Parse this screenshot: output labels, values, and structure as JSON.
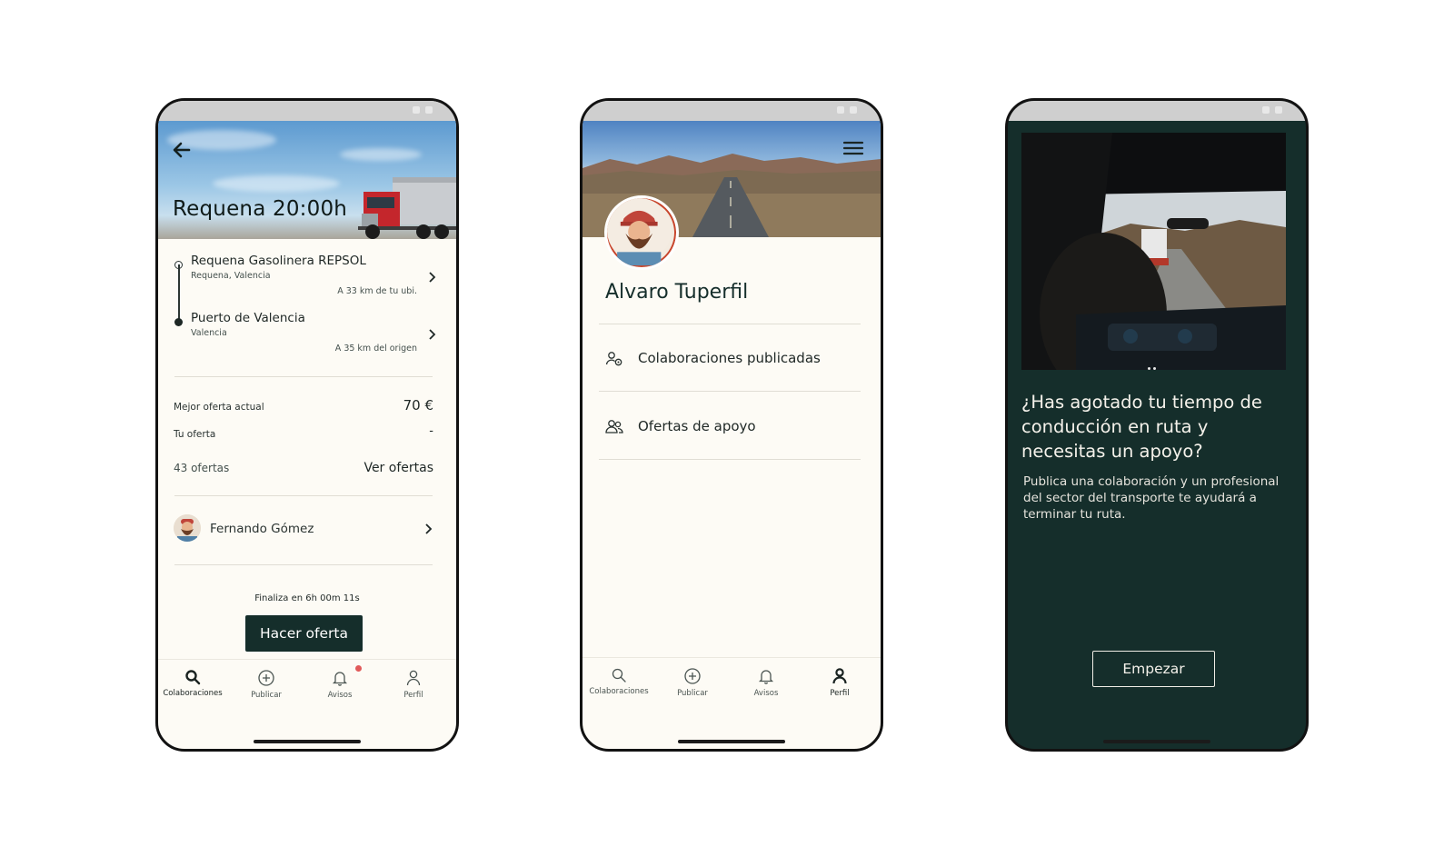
{
  "colors": {
    "primary": "#152e2b",
    "background": "#fdfbf5",
    "badge": "#e15a5a"
  },
  "screen_detail": {
    "title": "Requena 20:00h",
    "origin": {
      "name": "Requena Gasolinera REPSOL",
      "location": "Requena, Valencia",
      "distance": "A 33 km de tu ubi."
    },
    "destination": {
      "name": "Puerto de Valencia",
      "location": "Valencia",
      "distance": "A 35 km del origen"
    },
    "best_offer_label": "Mejor oferta actual",
    "best_offer_value": "70 €",
    "your_offer_label": "Tu oferta",
    "your_offer_value": "-",
    "offers_count": "43 ofertas",
    "see_offers": "Ver ofertas",
    "user_name": "Fernando Gómez",
    "ends_in": "Finaliza en 6h 00m 11s",
    "make_offer_button": "Hacer oferta"
  },
  "screen_profile": {
    "name": "Alvaro Tuperfil",
    "items": [
      {
        "label": "Colaboraciones publicadas",
        "icon": "users-settings-icon"
      },
      {
        "label": "Ofertas de apoyo",
        "icon": "users-icon"
      }
    ]
  },
  "screen_onboarding": {
    "title": "¿Has agotado tu tiempo de conducción en ruta y necesitas un apoyo?",
    "body": "Publica una colaboración y un profesional del sector del transporte te ayudará a terminar tu ruta.",
    "start_button": "Empezar"
  },
  "tabbar": {
    "tabs": [
      {
        "label": "Colaboraciones",
        "icon": "search-icon"
      },
      {
        "label": "Publicar",
        "icon": "plus-circle-icon"
      },
      {
        "label": "Avisos",
        "icon": "bell-icon"
      },
      {
        "label": "Perfil",
        "icon": "user-icon"
      }
    ]
  }
}
